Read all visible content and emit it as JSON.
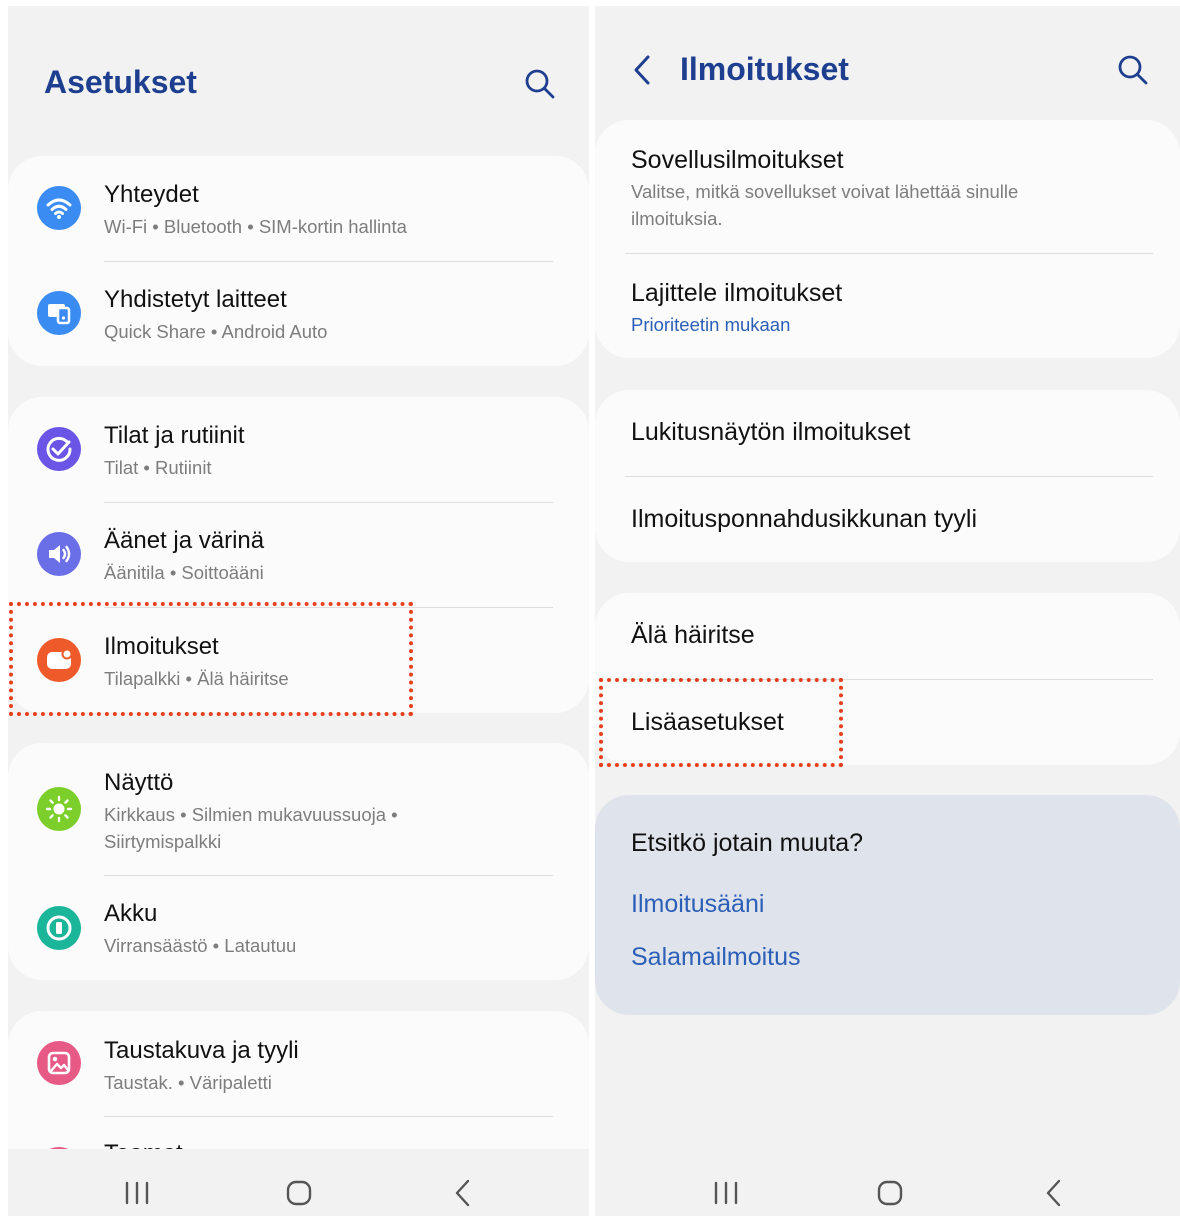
{
  "left_screen": {
    "title": "Asetukset",
    "groups": [
      {
        "items": [
          {
            "title": "Yhteydet",
            "subtitle": "Wi-Fi  •  Bluetooth  •  SIM-kortin hallinta",
            "icon": "wifi-icon",
            "icon_color": "#3a8bf2"
          },
          {
            "title": "Yhdistetyt laitteet",
            "subtitle": "Quick Share  •  Android Auto",
            "icon": "connected-devices-icon",
            "icon_color": "#3a8bf2"
          }
        ]
      },
      {
        "items": [
          {
            "title": "Tilat ja rutiinit",
            "subtitle": "Tilat  •  Rutiinit",
            "icon": "modes-routines-icon",
            "icon_color": "#6a55e6"
          },
          {
            "title": "Äänet ja värinä",
            "subtitle": "Äänitila  •  Soittoääni",
            "icon": "volume-icon",
            "icon_color": "#6a6fe8"
          },
          {
            "title": "Ilmoitukset",
            "subtitle": "Tilapalkki  •  Älä häiritse",
            "icon": "notifications-icon",
            "icon_color": "#ee5a2a"
          }
        ]
      },
      {
        "items": [
          {
            "title": "Näyttö",
            "subtitle_line1": "Kirkkaus  •  Silmien mukavuussuoja  •",
            "subtitle_line2": "Siirtymispalkki",
            "icon": "brightness-icon",
            "icon_color": "#7ccf2a"
          },
          {
            "title": "Akku",
            "subtitle": "Virransäästö  •  Latautuu",
            "icon": "battery-icon",
            "icon_color": "#1bb59a"
          }
        ]
      },
      {
        "items": [
          {
            "title": "Taustakuva ja tyyli",
            "subtitle": "Taustak.  •  Väripaletti",
            "icon": "wallpaper-icon",
            "icon_color": "#e85a86"
          },
          {
            "title": "Teemat",
            "icon": "themes-icon",
            "icon_color": "#e85a86"
          }
        ]
      }
    ]
  },
  "right_screen": {
    "title": "Ilmoitukset",
    "groups": [
      {
        "items": [
          {
            "title": "Sovellusilmoitukset",
            "subtitle": "Valitse, mitkä sovellukset voivat lähettää sinulle ilmoituksia."
          },
          {
            "title": "Lajittele ilmoitukset",
            "value": "Prioriteetin mukaan"
          }
        ]
      },
      {
        "items": [
          {
            "title": "Lukitusnäytön ilmoitukset"
          },
          {
            "title": "Ilmoitusponnahdusikkunan tyyli"
          }
        ]
      },
      {
        "items": [
          {
            "title": "Älä häiritse"
          },
          {
            "title": "Lisäasetukset"
          }
        ]
      }
    ],
    "suggestions": {
      "heading": "Etsitkö jotain muuta?",
      "links": [
        "Ilmoitusääni",
        "Salamailmoitus"
      ]
    }
  },
  "colors": {
    "title": "#1e3f8f",
    "link": "#2b5fb8",
    "highlight": "#e8401c"
  }
}
